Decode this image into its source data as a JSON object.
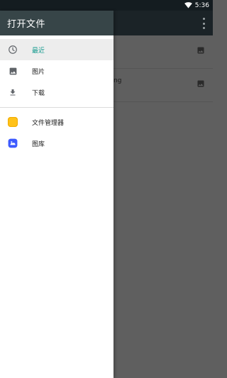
{
  "status_bar": {
    "time": "5:36",
    "icons": [
      "wifi-icon"
    ]
  },
  "background_app": {
    "rows": [
      {
        "label": "",
        "icon": "image-icon"
      },
      {
        "label": "ng",
        "icon": "image-icon"
      }
    ]
  },
  "drawer": {
    "title": "打开文件",
    "items": [
      {
        "label": "最近",
        "icon": "clock-icon",
        "active": true
      },
      {
        "label": "图片",
        "icon": "image-icon",
        "active": false
      },
      {
        "label": "下载",
        "icon": "download-icon",
        "active": false
      }
    ],
    "apps": [
      {
        "label": "文件管理器",
        "icon": "file-manager-icon"
      },
      {
        "label": "图库",
        "icon": "gallery-icon"
      }
    ]
  },
  "colors": {
    "accent": "#169b8f",
    "drawer_header": "#374548",
    "status_bar": "#141c20",
    "scrim": "#5f5f5f"
  }
}
